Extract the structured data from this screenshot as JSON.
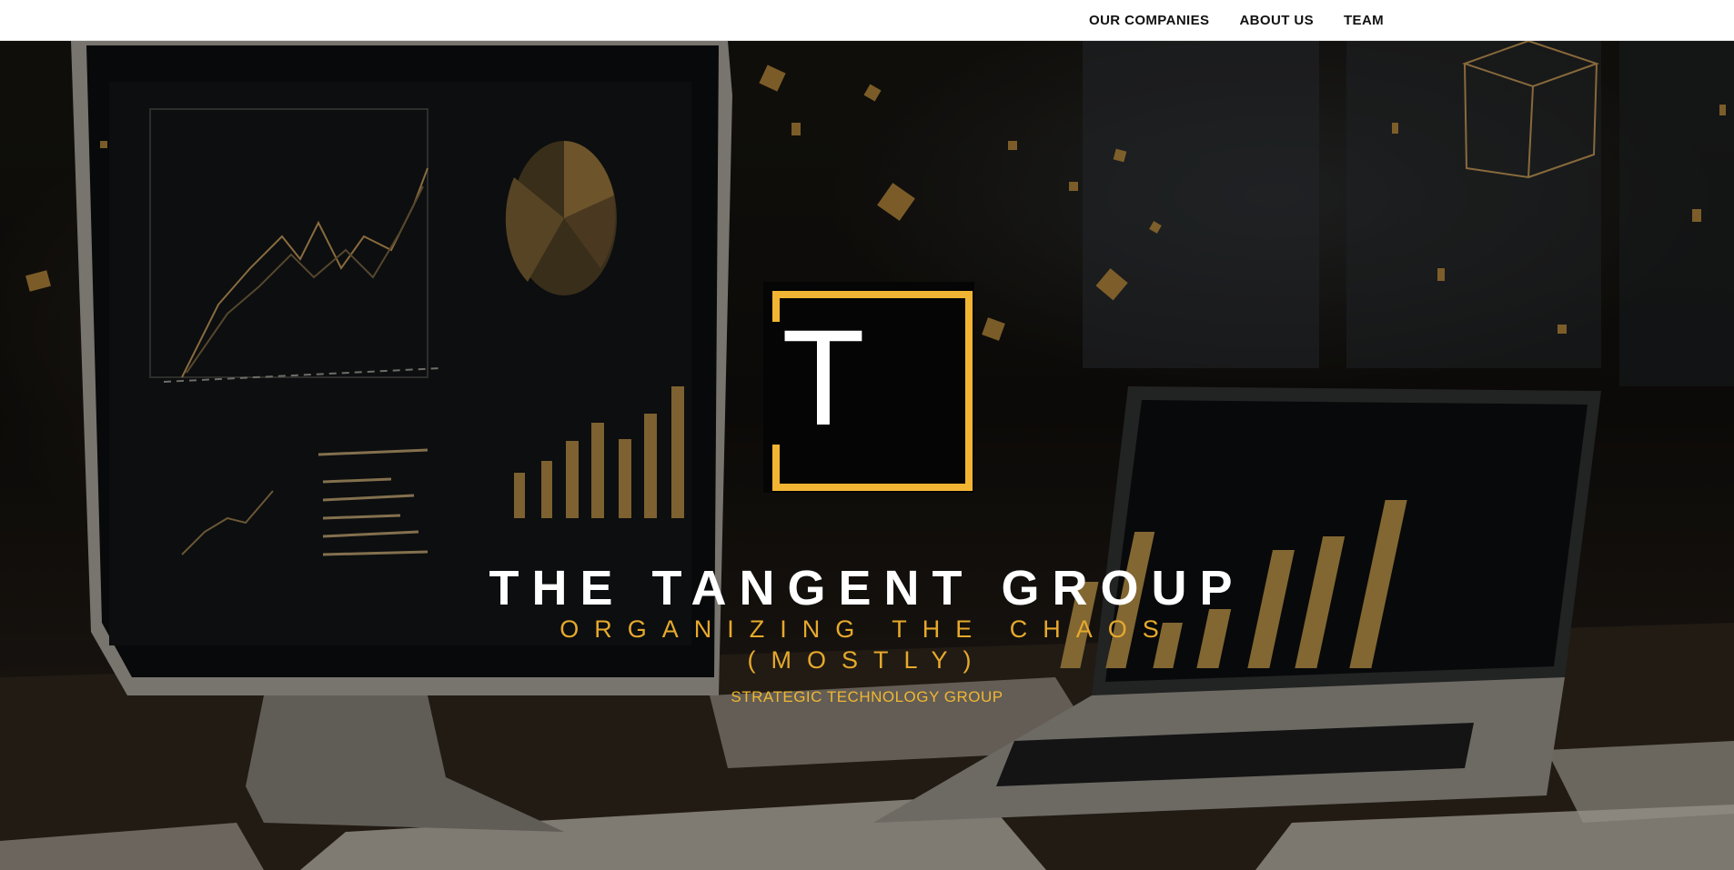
{
  "nav": {
    "items": [
      {
        "label": "OUR COMPANIES"
      },
      {
        "label": "ABOUT US"
      },
      {
        "label": "TEAM"
      }
    ]
  },
  "hero": {
    "logo_letter": "T",
    "title": "THE TANGENT GROUP",
    "tagline_line1": "ORGANIZING THE CHAOS",
    "tagline_line2": "(MOSTLY)",
    "subtitle": "STRATEGIC TECHNOLOGY GROUP",
    "background_image": "desk-with-monitor-and-laptop-showing-charts",
    "accent_color": "#f2b533",
    "text_color": "#ffffff"
  }
}
